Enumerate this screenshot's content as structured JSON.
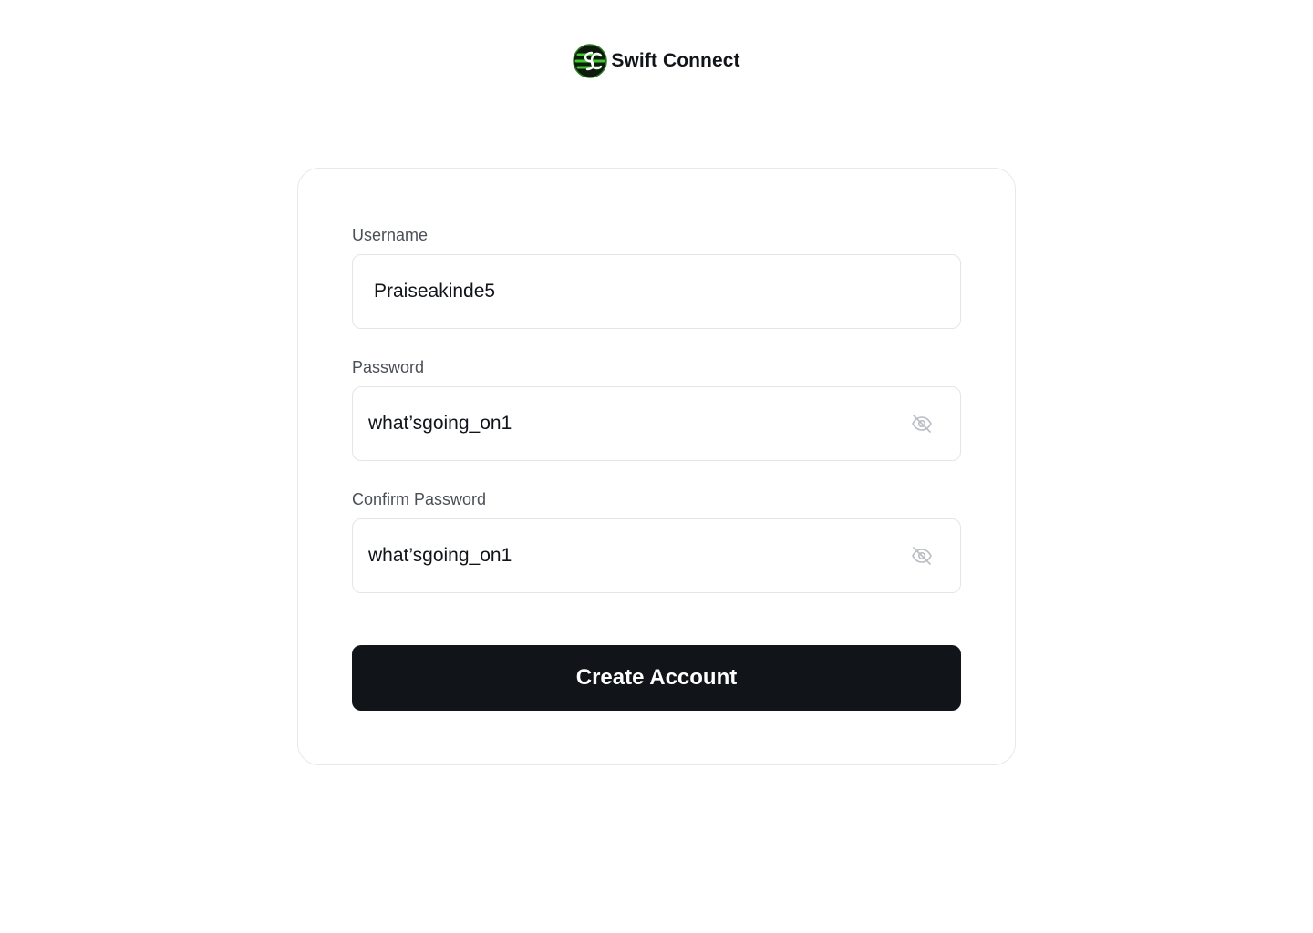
{
  "brand": {
    "name": "Swift Connect",
    "logo_icon": "sc-logo-icon",
    "logo_colors": {
      "ring": "#0f1a0f",
      "accent": "#3ecb2a"
    }
  },
  "form": {
    "username": {
      "label": "Username",
      "value": "Praiseakinde5"
    },
    "password": {
      "label": "Password",
      "value": "what’sgoing_on1",
      "toggle_icon": "eye-off-icon"
    },
    "confirm_password": {
      "label": "Confirm Password",
      "value": "what’sgoing_on1",
      "toggle_icon": "eye-off-icon"
    },
    "submit_label": "Create Account"
  },
  "colors": {
    "button_bg": "#111418",
    "border": "#e3e5e8",
    "label": "#4b4f56"
  }
}
